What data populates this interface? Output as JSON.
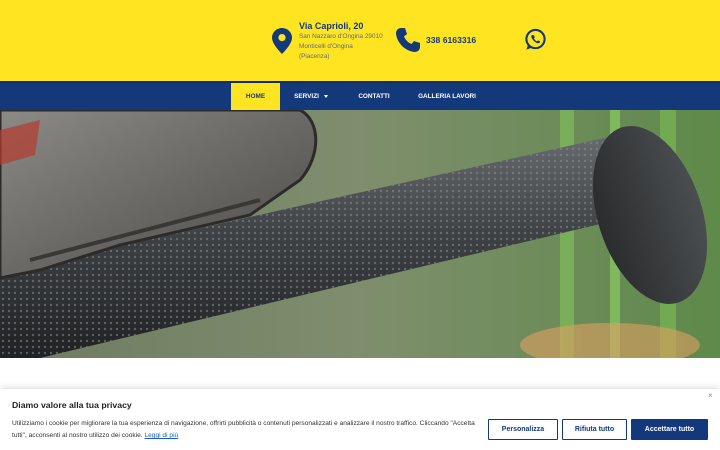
{
  "header": {
    "address": {
      "title": "Via Caprioli, 20",
      "line1": "San Nazzaro d'Ongina 29010",
      "line2": "Monticelli d'Ongina",
      "line3": "(Piacenza)"
    },
    "phone": "338 6163316",
    "icons": {
      "location": "map-pin-icon",
      "phone": "phone-icon",
      "whatsapp": "whatsapp-icon"
    }
  },
  "nav": {
    "items": [
      {
        "label": "HOME",
        "active": true
      },
      {
        "label": "SERVIZI",
        "has_dropdown": true
      },
      {
        "label": "CONTATTI"
      },
      {
        "label": "GALLERIA LAVORI"
      }
    ]
  },
  "cookie": {
    "title": "Diamo valore alla tua privacy",
    "text": "Utilizziamo i cookie per migliorare la tua esperienza di navigazione, offrirti pubblicità o contenuti personalizzati e analizzare il nostro traffico. Cliccando \"Accetta tutti\", acconsenti al nostro utilizzo dei cookie.",
    "link": "Leggi di più",
    "close": "×",
    "buttons": {
      "customize": "Personalizza",
      "reject": "Rifiuta tutto",
      "accept": "Accettare tutto"
    }
  },
  "colors": {
    "brand_yellow": "#ffe521",
    "brand_blue": "#14397a"
  }
}
